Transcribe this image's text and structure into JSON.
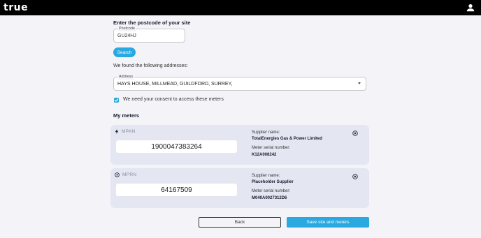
{
  "header": {
    "logo_text": "true"
  },
  "postcode_section": {
    "title": "Enter the postcode of your site",
    "field_label": "Postcode",
    "field_value": "GU24HJ",
    "search_label": "Search"
  },
  "addresses": {
    "found_text": "We found the following addresses:",
    "field_label": "Address",
    "selected": "HAYS HOUSE, MILLMEAD, GUILDFORD, SURREY,"
  },
  "consent": {
    "label": "We need your consent to access these meters",
    "checked": true
  },
  "meters": {
    "title": "My meters",
    "items": [
      {
        "type": "MPAN",
        "icon": "lightning-icon",
        "number": "1900047383264",
        "supplier_label": "Supplier name:",
        "supplier_name": "TotalEnergies Gas & Power Limited",
        "serial_label": "Meter serial number:",
        "serial_value": "K12A008242"
      },
      {
        "type": "MPRN",
        "icon": "flame-icon",
        "number": "64167509",
        "supplier_label": "Supplier name:",
        "supplier_name": "Placeholder Supplier",
        "serial_label": "Meter serial number:",
        "serial_value": "M040A0027312D6"
      }
    ]
  },
  "actions": {
    "back_label": "Back",
    "save_label": "Save site and meters"
  },
  "colors": {
    "accent": "#2aa9e0",
    "topbar": "#000000",
    "card": "#e4e6f2"
  }
}
